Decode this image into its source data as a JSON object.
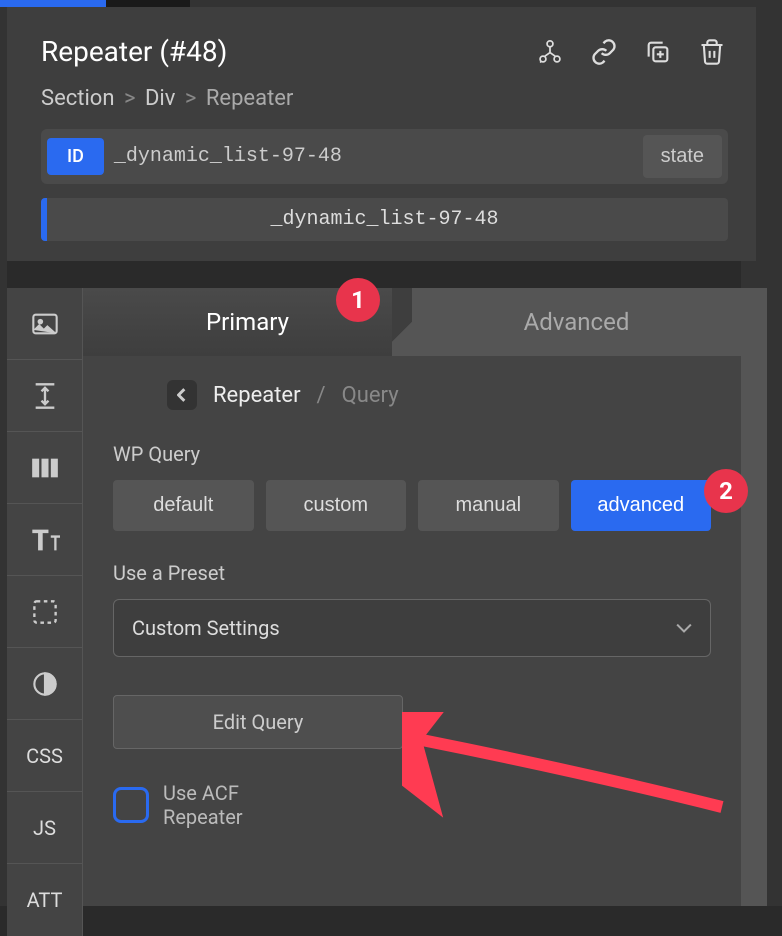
{
  "header": {
    "title": "Repeater (#48)",
    "breadcrumb": {
      "items": [
        "Section",
        "Div",
        "Repeater"
      ]
    },
    "id_badge": "ID",
    "id_value": "_dynamic_list-97-48",
    "state_button": "state",
    "class_value": "_dynamic_list-97-48"
  },
  "sidebar": {
    "items": [
      {
        "name": "image",
        "type": "icon"
      },
      {
        "name": "spacing",
        "type": "icon"
      },
      {
        "name": "columns",
        "type": "icon"
      },
      {
        "name": "typography",
        "type": "icon"
      },
      {
        "name": "border",
        "type": "icon"
      },
      {
        "name": "effects",
        "type": "icon"
      },
      {
        "name": "css",
        "label": "CSS"
      },
      {
        "name": "js",
        "label": "JS"
      },
      {
        "name": "att",
        "label": "ATT"
      }
    ]
  },
  "tabs": {
    "primary": "Primary",
    "advanced": "Advanced"
  },
  "sub_breadcrumb": {
    "parent": "Repeater",
    "current": "Query"
  },
  "wp_query": {
    "label": "WP Query",
    "options": [
      "default",
      "custom",
      "manual",
      "advanced"
    ],
    "active": "advanced"
  },
  "preset": {
    "label": "Use a Preset",
    "selected": "Custom Settings"
  },
  "edit_query_button": "Edit Query",
  "acf_checkbox": {
    "label": "Use ACF\nRepeater"
  },
  "annotations": {
    "badge_1": "1",
    "badge_2": "2"
  }
}
